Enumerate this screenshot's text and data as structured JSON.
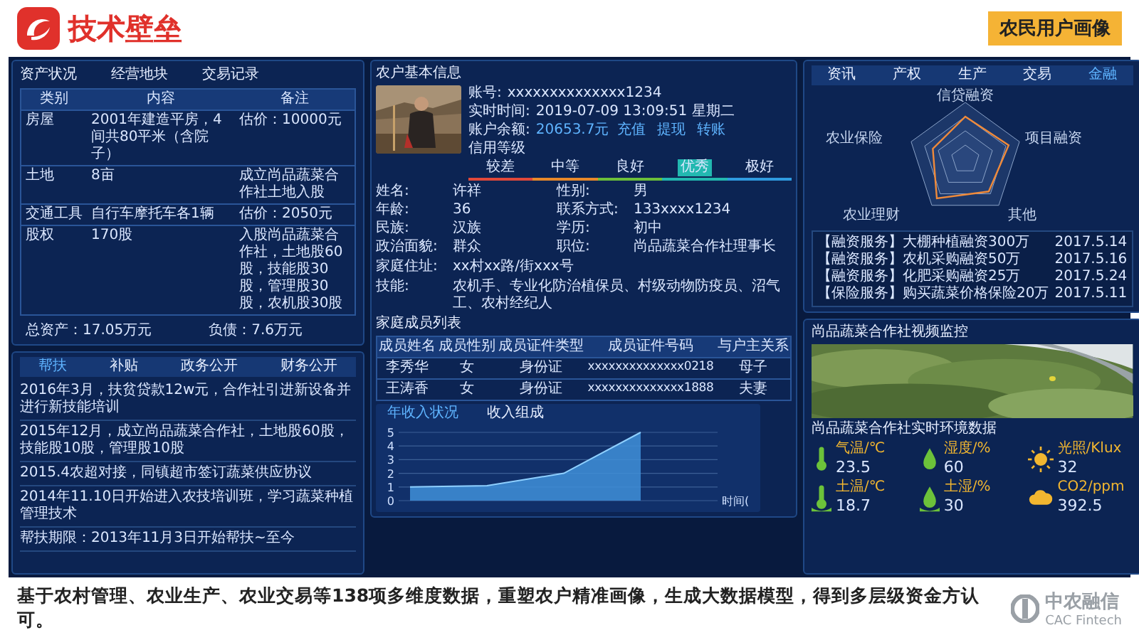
{
  "header": {
    "title": "技术壁垒",
    "badge": "农民用户画像"
  },
  "assets": {
    "tabs": [
      "资产状况",
      "经营地块",
      "交易记录"
    ],
    "columns": [
      "类别",
      "内容",
      "备注"
    ],
    "rows": [
      [
        "房屋",
        "2001年建造平房，4间共80平米（含院子）",
        "估价：10000元"
      ],
      [
        "土地",
        "8亩",
        "成立尚品蔬菜合作社土地入股"
      ],
      [
        "交通工具",
        "自行车摩托车各1辆",
        "估价：2050元"
      ],
      [
        "股权",
        "170股",
        "入股尚品蔬菜合作社，土地股60股，技能股30股，管理股30股，农机股30股"
      ]
    ],
    "total_assets": "总资产：17.05万元",
    "liabilities": "负债：7.6万元"
  },
  "aid": {
    "tabs": [
      {
        "label": "帮扶",
        "selected": true
      },
      {
        "label": "补贴",
        "selected": false
      },
      {
        "label": "政务公开",
        "selected": false
      },
      {
        "label": "财务公开",
        "selected": false
      }
    ],
    "items": [
      "2016年3月，扶贫贷款12w元，合作社引进新设备并进行新技能培训",
      "2015年12月，成立尚品蔬菜合作社，土地股60股，技能股10股，管理股10股",
      "2015.4农超对接，同镇超市签订蔬菜供应协议",
      "2014年11.10日开始进入农技培训班，学习蔬菜种植管理技术",
      "帮扶期限：2013年11月3日开始帮扶~至今"
    ]
  },
  "farmer": {
    "title": "农户基本信息",
    "account_label": "账号:",
    "account": "xxxxxxxxxxxxxx1234",
    "time_label": "实时时间:",
    "time": "2019-07-09 13:09:51 星期二",
    "balance_label": "账户余额:",
    "balance": "20653.7元",
    "actions": [
      "充值",
      "提现",
      "转账"
    ],
    "credit_label": "信用等级",
    "credit_levels": [
      {
        "label": "较差",
        "selected": false,
        "color": "#e0483a"
      },
      {
        "label": "中等",
        "selected": false,
        "color": "#e8882a"
      },
      {
        "label": "良好",
        "selected": false,
        "color": "#6cbf3a"
      },
      {
        "label": "优秀",
        "selected": true,
        "color": "#22b8b0"
      },
      {
        "label": "极好",
        "selected": false,
        "color": "#2f9be0"
      }
    ],
    "fields": [
      {
        "label": "姓名:",
        "value": "许祥"
      },
      {
        "label": "性别:",
        "value": "男"
      },
      {
        "label": "年龄:",
        "value": "36"
      },
      {
        "label": "联系方式:",
        "value": "133xxxx1234"
      },
      {
        "label": "民族:",
        "value": "汉族"
      },
      {
        "label": "学历:",
        "value": "初中"
      },
      {
        "label": "政治面貌:",
        "value": "群众"
      },
      {
        "label": "职位:",
        "value": "尚品蔬菜合作社理事长"
      }
    ],
    "address": {
      "label": "家庭住址:",
      "value": "xx村xx路/街xxx号"
    },
    "skills": {
      "label": "技能:",
      "value": "农机手、专业化防治植保员、村级动物防疫员、沼气工、农村经纪人"
    }
  },
  "family": {
    "title": "家庭成员列表",
    "columns": [
      "成员姓名",
      "成员性别",
      "成员证件类型",
      "成员证件号码",
      "与户主关系"
    ],
    "rows": [
      [
        "李秀华",
        "女",
        "身份证",
        "xxxxxxxxxxxxxx0218",
        "母子"
      ],
      [
        "王涛香",
        "女",
        "身份证",
        "xxxxxxxxxxxxxx1888",
        "夫妻"
      ]
    ]
  },
  "income": {
    "tabs": [
      {
        "label": "年收入状况",
        "selected": true
      },
      {
        "label": "收入组成",
        "selected": false
      }
    ],
    "chart_data": {
      "type": "area",
      "grid": true,
      "xlabel": "时间(",
      "ylim": [
        0,
        5
      ],
      "yticks": [
        0,
        1,
        2,
        3,
        4,
        5
      ],
      "values": [
        1,
        1.1,
        2,
        5
      ]
    }
  },
  "finance": {
    "tabs": [
      {
        "label": "资讯",
        "selected": false
      },
      {
        "label": "产权",
        "selected": false
      },
      {
        "label": "生产",
        "selected": false
      },
      {
        "label": "交易",
        "selected": false
      },
      {
        "label": "金融",
        "selected": true
      }
    ],
    "radar_labels": [
      "信贷融资",
      "项目融资",
      "其他",
      "农业理财",
      "农业保险"
    ],
    "news": [
      {
        "text": "【融资服务】大棚种植融资300万",
        "date": "2017.5.14"
      },
      {
        "text": "【融资服务】农机采购融资50万",
        "date": "2017.5.16"
      },
      {
        "text": "【融资服务】化肥采购融资25万",
        "date": "2017.5.24"
      },
      {
        "text": "【保险服务】购买蔬菜价格保险20万",
        "date": "2017.5.11"
      }
    ]
  },
  "video": {
    "title": "尚品蔬菜合作社视频监控"
  },
  "environment": {
    "title": "尚品蔬菜合作社实时环境数据",
    "sensors": [
      {
        "kind": "thermometer",
        "label": "气温/℃",
        "value": "23.5"
      },
      {
        "kind": "drop",
        "label": "湿度/%",
        "value": "60"
      },
      {
        "kind": "sun",
        "label": "光照/Klux",
        "value": "32"
      },
      {
        "kind": "soil-thermometer",
        "label": "土温/℃",
        "value": "18.7"
      },
      {
        "kind": "soil-drop",
        "label": "土湿/%",
        "value": "30"
      },
      {
        "kind": "cloud",
        "label": "CO2/ppm",
        "value": "392.5"
      }
    ]
  },
  "caption": "基于农村管理、农业生产、农业交易等138项多维度数据，重塑农户精准画像，生成大数据模型，得到多层级资金方认可。",
  "brand": {
    "name": "中农融信",
    "sub": "CAC Fintech"
  }
}
